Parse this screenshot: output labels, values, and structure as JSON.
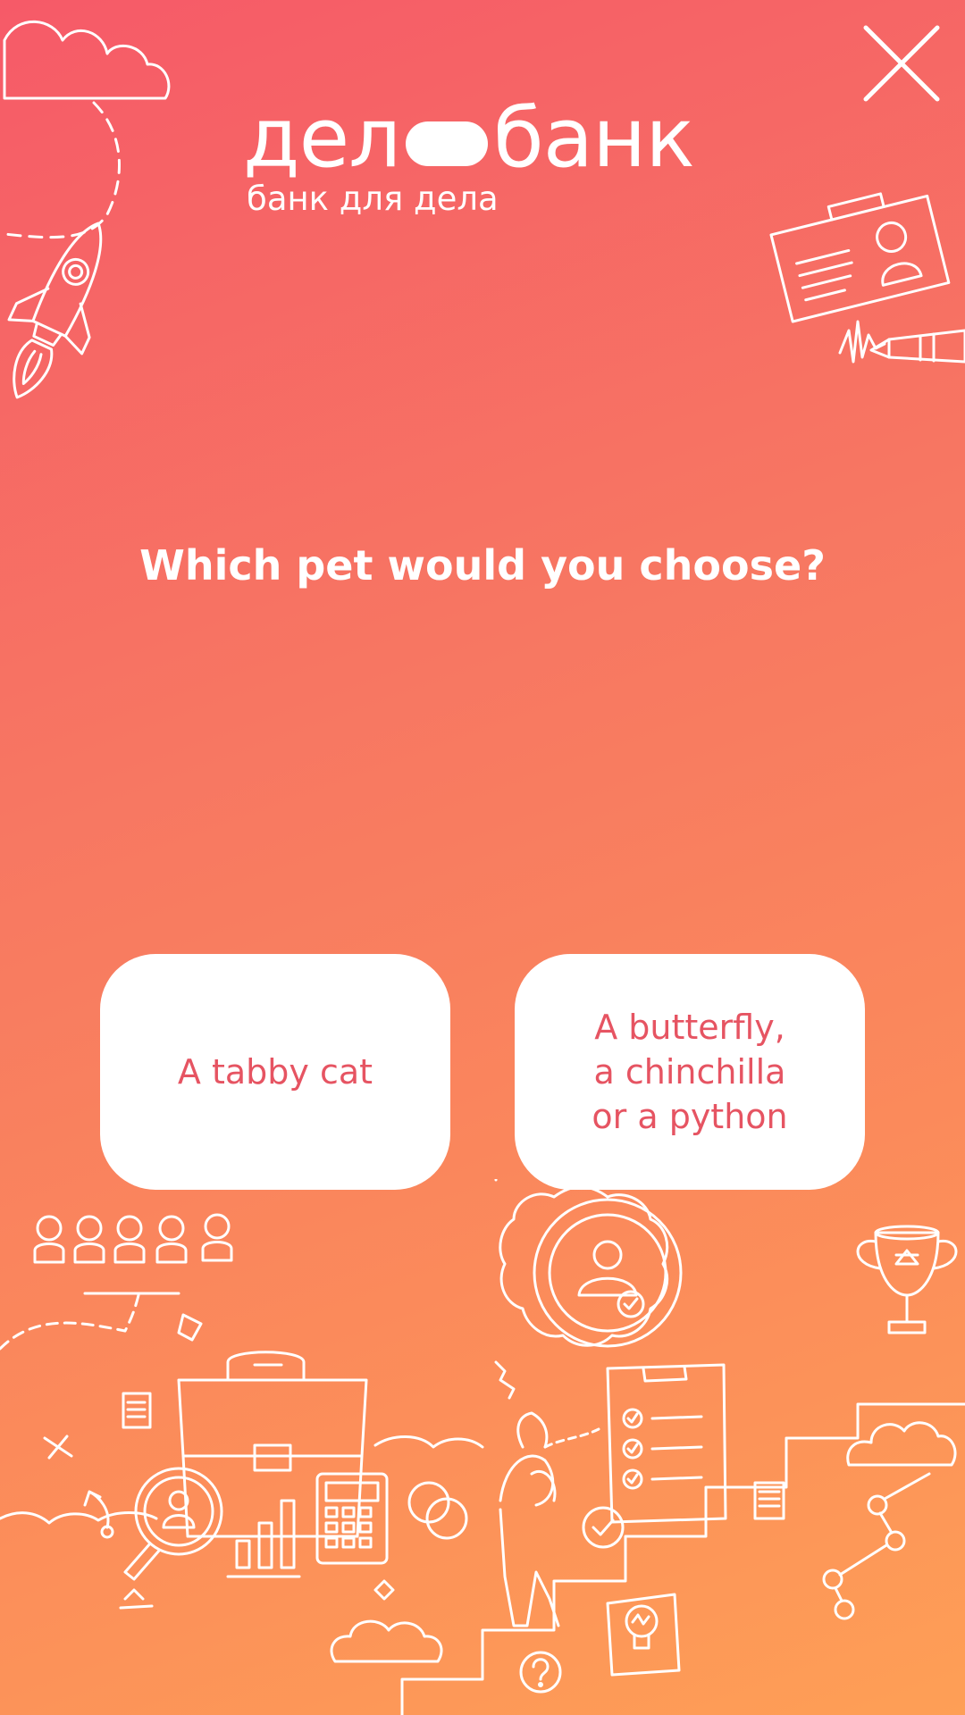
{
  "logo": {
    "word_left": "дел",
    "word_right": "банк",
    "tagline": "банк для дела"
  },
  "question": "Which pet would you choose?",
  "answers": [
    {
      "label": "A tabby cat"
    },
    {
      "label": "A butterfly,\na chinchilla\nor a python"
    }
  ],
  "colors": {
    "gradient_top": "#f65a68",
    "gradient_bottom": "#fe9f56",
    "answer_text": "#e65462",
    "card_bg": "#ffffff"
  },
  "icons": [
    "close-icon",
    "cloud-icon",
    "rocket-icon",
    "id-card-icon",
    "pen-icon",
    "people-icon",
    "briefcase-icon",
    "magnifier-icon",
    "calculator-icon",
    "bar-chart-icon",
    "gear-icon",
    "clipboard-checklist-icon",
    "trophy-icon",
    "stairs-icon",
    "person-icon",
    "lightbulb-icon",
    "question-icon",
    "network-icon",
    "document-icon"
  ]
}
